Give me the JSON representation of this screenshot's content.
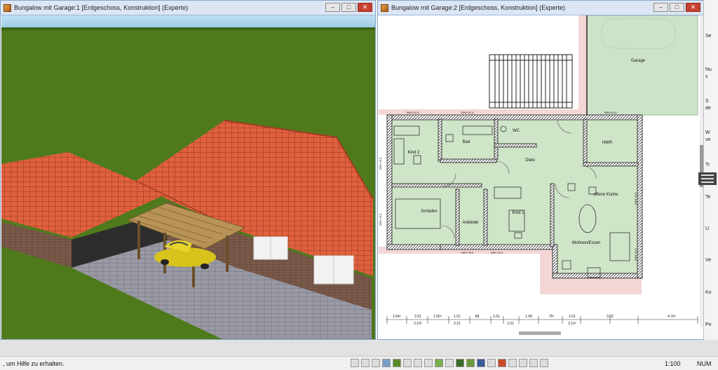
{
  "window1": {
    "title": "Bungalow mit Garage:1 [Erdgeschoss, Konstruktion] (Experte)"
  },
  "window2": {
    "title": "Bungalow mit Garage:2 [Erdgeschoss, Konstruktion] (Experte)"
  },
  "window_buttons": {
    "minimize": "–",
    "maximize": "□",
    "close": "✕"
  },
  "plan": {
    "rooms": [
      {
        "id": "garage",
        "label": "Garage"
      },
      {
        "id": "kind2",
        "label": "Kind 2"
      },
      {
        "id": "bad",
        "label": "Bad"
      },
      {
        "id": "wc",
        "label": "WC"
      },
      {
        "id": "hwr",
        "label": "HWR"
      },
      {
        "id": "diele",
        "label": "Diele"
      },
      {
        "id": "kueche",
        "label": "offene Küche"
      },
      {
        "id": "schlafen",
        "label": "Schlafen"
      },
      {
        "id": "ankleide",
        "label": "Ankleide"
      },
      {
        "id": "kind1",
        "label": "Kind 1"
      },
      {
        "id": "wohnen",
        "label": "Wohnen/Essen"
      }
    ],
    "brh_labels": [
      "BRH 62,5",
      "BRH 62,5",
      "BRH 62,5",
      "BRH 25,0",
      "BRH 25,0",
      "BRH 25,0",
      "BRH 25,0",
      "BRH 25,0",
      "BRH 25,0"
    ],
    "dim_labels": [
      "1.64⁵",
      "2.01",
      "2.13⁵",
      "1.50⁵",
      "1.01",
      "2.21",
      ".88",
      "1.01",
      "1.01",
      "1.58",
      ".75⁵",
      "2.01",
      "2.13⁵",
      "3.02",
      "4.76⁵"
    ]
  },
  "right_panel": {
    "items": [
      "Se",
      "Nu",
      "s",
      "S",
      "de",
      "W",
      "ve",
      "Tr",
      "Te",
      "U",
      "Ve",
      "Ko",
      "Po"
    ]
  },
  "status": {
    "hint": ", um Hilfe zu erhalten.",
    "scale": "1:100",
    "numlock": "NUM"
  }
}
